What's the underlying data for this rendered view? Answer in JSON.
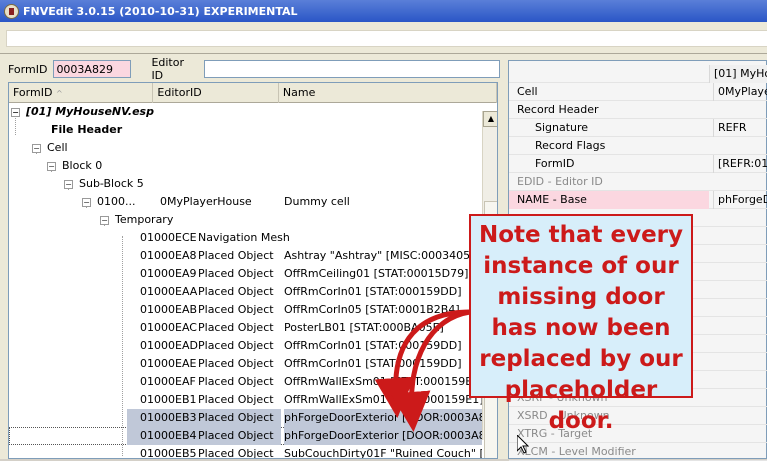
{
  "window": {
    "title": "FNVEdit 3.0.15 (2010-10-31) EXPERIMENTAL"
  },
  "filters": {
    "formid_label": "FormID",
    "formid_value": "0003A829",
    "editorid_label": "Editor ID",
    "editorid_value": ""
  },
  "tree": {
    "columns": [
      "FormID",
      "EditorID",
      "Name"
    ],
    "sort_indicator": "^",
    "nodes": {
      "plugin": "[01] MyHouseNV.esp",
      "file_header": "File Header",
      "cell": "Cell",
      "block": "Block 0",
      "subblock": "Sub-Block 5",
      "cell_record": {
        "formid": "0100...",
        "editorid": "0MyPlayerHouse",
        "name": "Dummy cell"
      },
      "temporary": "Temporary"
    },
    "rows": [
      {
        "formid": "01000ECE",
        "type": "Navigation Mesh",
        "name": ""
      },
      {
        "formid": "01000EA8",
        "type": "Placed Object",
        "name": "Ashtray \"Ashtray\" [MISC:00034057]"
      },
      {
        "formid": "01000EA9",
        "type": "Placed Object",
        "name": "OffRmCeiling01 [STAT:00015D79]"
      },
      {
        "formid": "01000EAA",
        "type": "Placed Object",
        "name": "OffRmCorIn01 [STAT:000159DD]"
      },
      {
        "formid": "01000EAB",
        "type": "Placed Object",
        "name": "OffRmCorIn05 [STAT:0001B2B4]"
      },
      {
        "formid": "01000EAC",
        "type": "Placed Object",
        "name": "PosterLB01 [STAT:000BA05E]"
      },
      {
        "formid": "01000EAD",
        "type": "Placed Object",
        "name": "OffRmCorIn01 [STAT:000159DD]"
      },
      {
        "formid": "01000EAE",
        "type": "Placed Object",
        "name": "OffRmCorIn01 [STAT:000159DD]"
      },
      {
        "formid": "01000EAF",
        "type": "Placed Object",
        "name": "OffRmWallExSm01 [STAT:000159E1]"
      },
      {
        "formid": "01000EB1",
        "type": "Placed Object",
        "name": "OffRmWallExSm01 [STAT:000159E1]"
      },
      {
        "formid": "01000EB3",
        "type": "Placed Object",
        "name": "phForgeDoorExterior [DOOR:0003A8..."
      },
      {
        "formid": "01000EB4",
        "type": "Placed Object",
        "name": "phForgeDoorExterior [DOOR:0003A8..."
      },
      {
        "formid": "01000EB5",
        "type": "Placed Object",
        "name": "SubCouchDirty01F \"Ruined Couch\" [F..."
      }
    ]
  },
  "record_view": {
    "column_header": "[01] MyHou",
    "rows": [
      {
        "name": "Cell",
        "value": "0MyPlayer"
      },
      {
        "name": "Record Header",
        "value": ""
      },
      {
        "name": "Signature",
        "value": "REFR"
      },
      {
        "name": "Record Flags",
        "value": ""
      },
      {
        "name": "FormID",
        "value": "[REFR:010"
      },
      {
        "name": "EDID - Editor ID",
        "value": ""
      },
      {
        "name": "NAME - Base",
        "value": "phForgeDo"
      },
      {
        "name": "XSRF - Unknown",
        "value": ""
      },
      {
        "name": "XSRD - Unknown",
        "value": ""
      },
      {
        "name": "XTRG - Target",
        "value": ""
      },
      {
        "name": "XLCM - Level Modifier",
        "value": ""
      }
    ]
  },
  "callout": {
    "text": "Note that every instance of our missing door has now been replaced by our placeholder door."
  },
  "colors": {
    "callout_border": "#cc1a1a",
    "callout_fill": "#d7eefa",
    "selection": "#c0c8d8",
    "formid_field": "#fbd7e0"
  }
}
